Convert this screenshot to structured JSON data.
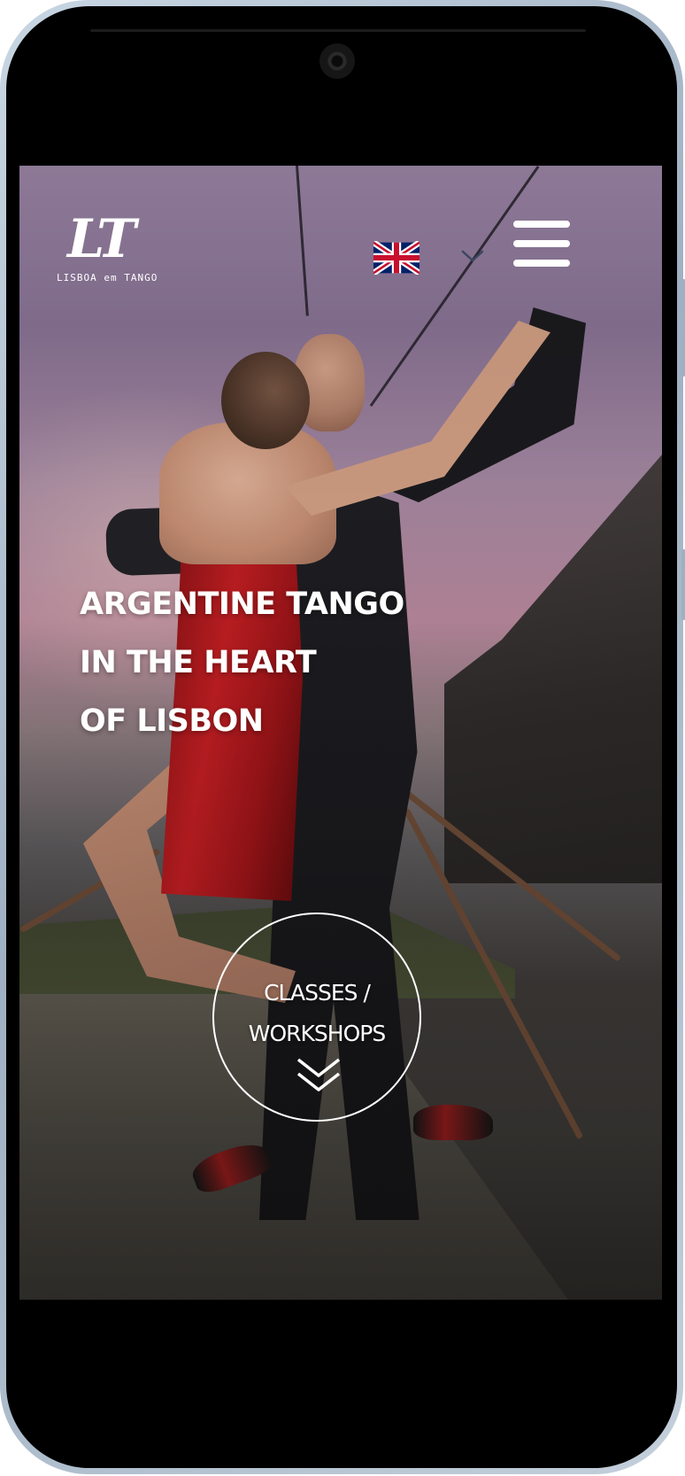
{
  "header": {
    "logo": {
      "mark": "LT",
      "tagline": "LISBOA em TANGO",
      "icon": "lisboa-em-tango-logo"
    },
    "language": {
      "flag_icon": "uk-flag-icon",
      "dropdown_icon": "chevron-down-icon"
    },
    "menu_icon": "hamburger-menu-icon"
  },
  "hero": {
    "headline_lines": [
      "ARGENTINE TANGO",
      "IN THE HEART",
      "OF LISBON"
    ],
    "cta": {
      "line1": "CLASSES /",
      "line2": "WORKSHOPS",
      "icon": "double-chevron-down-icon"
    }
  },
  "colors": {
    "text": "#ffffff",
    "device_frame": "#9fb0c2",
    "dress_red": "#c01e22"
  }
}
